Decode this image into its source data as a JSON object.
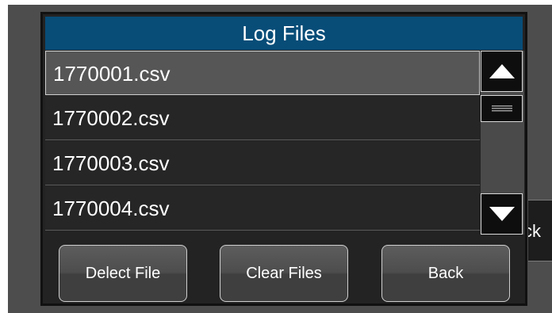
{
  "dialog": {
    "title": "Log Files"
  },
  "files": [
    {
      "name": "1770001.csv",
      "selected": true
    },
    {
      "name": "1770002.csv",
      "selected": false
    },
    {
      "name": "1770003.csv",
      "selected": false
    },
    {
      "name": "1770004.csv",
      "selected": false
    }
  ],
  "scrollbar": {
    "up_icon": "triangle-up-icon",
    "down_icon": "triangle-down-icon",
    "thumb_icon": "grip-lines-icon"
  },
  "buttons": {
    "delect_label": "Delect File",
    "clear_label": "Clear Files",
    "back_label": "Back"
  },
  "background": {
    "peek_label": "ck"
  },
  "colors": {
    "title_bar": "#074d78",
    "selected_row": "#565656",
    "row": "#262626"
  }
}
